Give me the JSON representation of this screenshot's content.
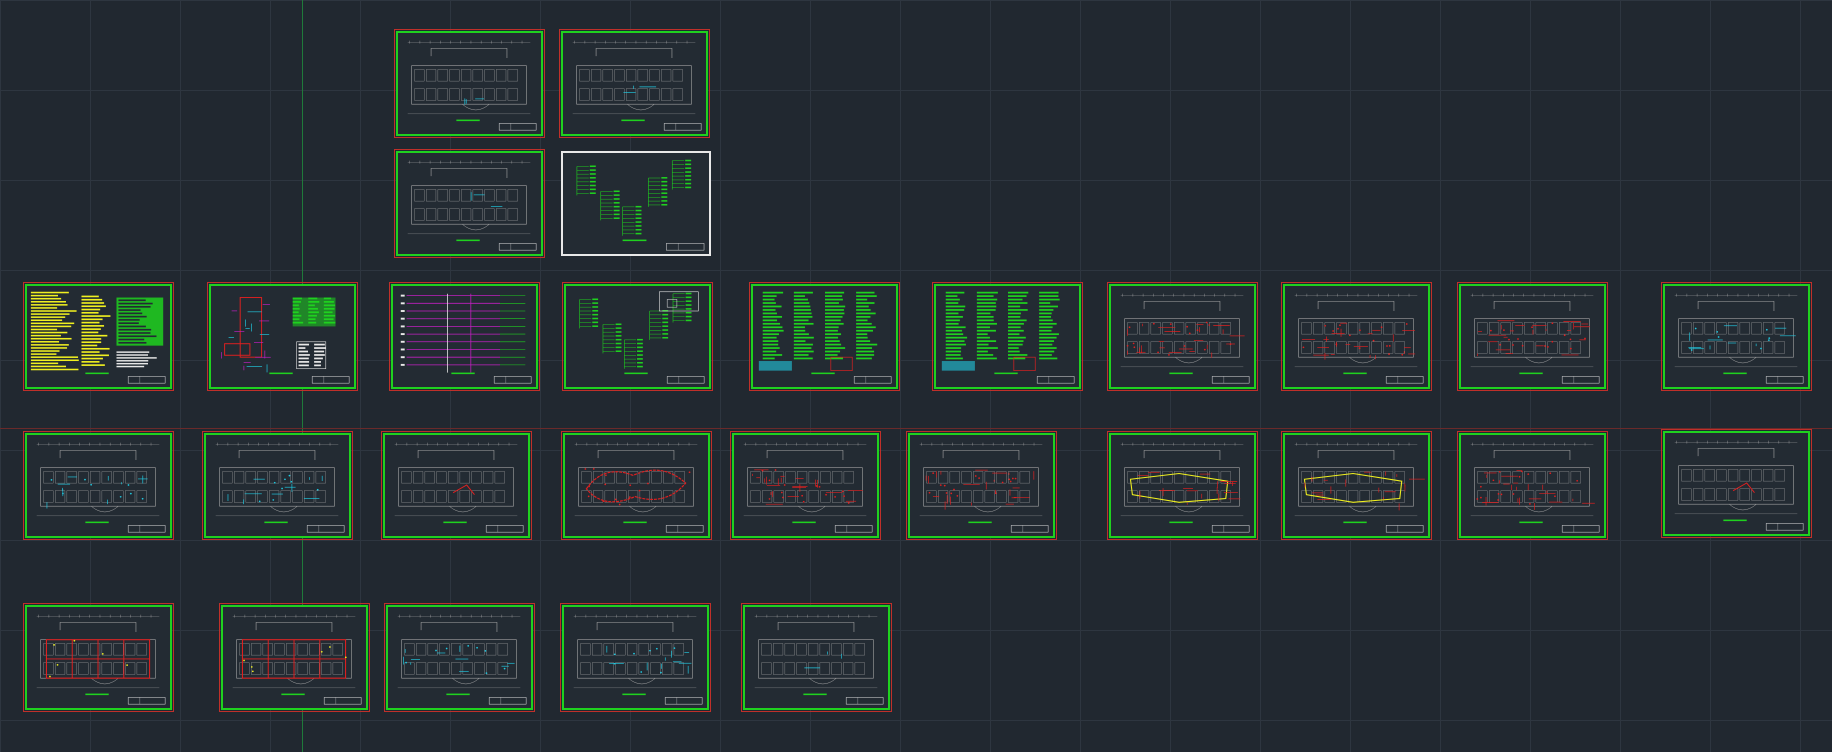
{
  "app": {
    "type": "CAD model space"
  },
  "colors": {
    "background": "#212830",
    "grid": "#2e3640",
    "frame_green": "#1fd11f",
    "frame_red": "#c0302a",
    "wire_red": "#e02020",
    "annotation_cyan": "#21c8e0",
    "notes_yellow": "#f0f020",
    "magenta": "#c020c0",
    "wall_gray": "#a8a8a8",
    "white_frame": "#e8e8e8"
  },
  "sheets": [
    {
      "id": "s01",
      "kind": "plan-light"
    },
    {
      "id": "s02",
      "kind": "plan-light"
    },
    {
      "id": "s03",
      "kind": "plan-light"
    },
    {
      "id": "s04",
      "kind": "schematic-white"
    },
    {
      "id": "s05",
      "kind": "notes"
    },
    {
      "id": "s06",
      "kind": "riser"
    },
    {
      "id": "s07",
      "kind": "system"
    },
    {
      "id": "s08",
      "kind": "schematic"
    },
    {
      "id": "s09",
      "kind": "schedule"
    },
    {
      "id": "s10",
      "kind": "schedule"
    },
    {
      "id": "s11",
      "kind": "plan-red"
    },
    {
      "id": "s12",
      "kind": "plan-red"
    },
    {
      "id": "s13",
      "kind": "plan-red"
    },
    {
      "id": "s14",
      "kind": "plan-cyan"
    },
    {
      "id": "s15",
      "kind": "plan-cyan"
    },
    {
      "id": "s16",
      "kind": "plan-cyan"
    },
    {
      "id": "s17",
      "kind": "plan-empty"
    },
    {
      "id": "s18",
      "kind": "plan-redloop"
    },
    {
      "id": "s19",
      "kind": "plan-red"
    },
    {
      "id": "s20",
      "kind": "plan-red"
    },
    {
      "id": "s21",
      "kind": "plan-yellow"
    },
    {
      "id": "s22",
      "kind": "plan-yellow"
    },
    {
      "id": "s23",
      "kind": "plan-red"
    },
    {
      "id": "s24",
      "kind": "plan-empty"
    },
    {
      "id": "s25",
      "kind": "plan-frame"
    },
    {
      "id": "s26",
      "kind": "plan-frame"
    },
    {
      "id": "s27",
      "kind": "plan-cyan"
    },
    {
      "id": "s28",
      "kind": "plan-cyan"
    },
    {
      "id": "s29",
      "kind": "plan-light"
    }
  ]
}
